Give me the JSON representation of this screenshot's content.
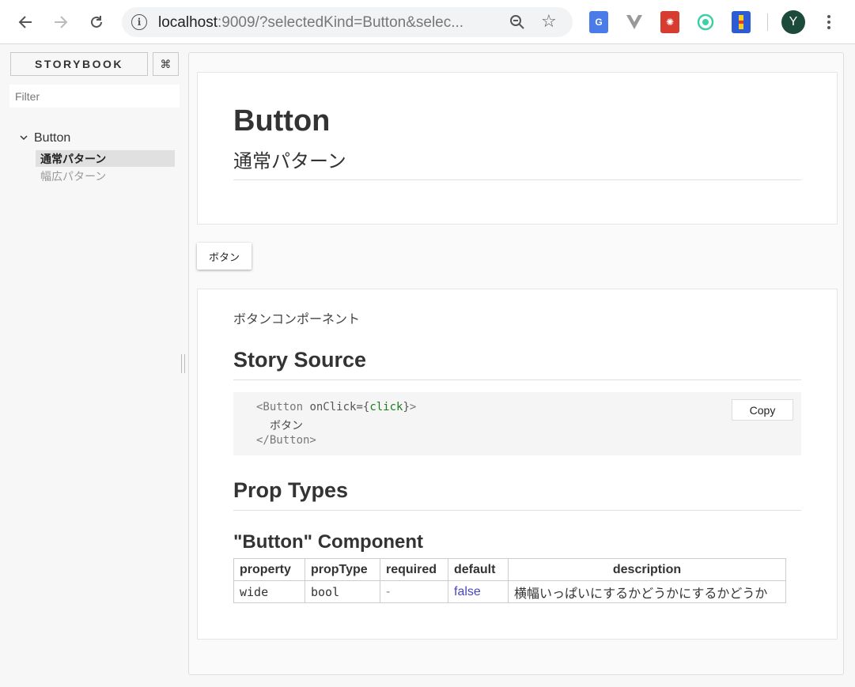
{
  "browser": {
    "url_host": "localhost",
    "url_rest": ":9009/?selectedKind=Button&selec...",
    "profile_initial": "Y",
    "extensions": [
      "google-translate-icon",
      "vue-devtools-icon",
      "bug-icon",
      "target-icon",
      "lighthouse-icon"
    ]
  },
  "sidebar": {
    "title": "STORYBOOK",
    "shortcut_icon": "⌘",
    "filter_placeholder": "Filter",
    "kind": "Button",
    "stories": [
      {
        "label": "通常パターン",
        "active": true
      },
      {
        "label": "幅広パターン",
        "active": false
      }
    ]
  },
  "preview": {
    "title": "Button",
    "subtitle": "通常パターン",
    "demo_button_label": "ボタン",
    "description": "ボタンコンポーネント",
    "story_source_heading": "Story Source",
    "code": {
      "open_tag_start": "<Button ",
      "attr": "onClick=",
      "brace_open": "{",
      "expr": "click",
      "brace_close": "}",
      "open_tag_end": ">",
      "child_text": "ボタン",
      "close_tag": "</Button>"
    },
    "copy_label": "Copy",
    "prop_types_heading": "Prop Types",
    "component_heading": "\"Button\" Component",
    "table": {
      "headers": [
        "property",
        "propType",
        "required",
        "default",
        "description"
      ],
      "rows": [
        [
          "wide",
          "bool",
          "-",
          "false",
          "横幅いっぱいにするかどうかにするかどうか"
        ]
      ]
    }
  }
}
